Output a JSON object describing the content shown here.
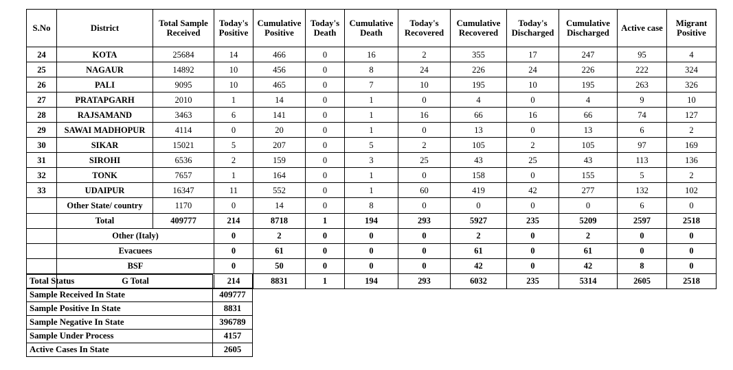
{
  "main_table": {
    "headers": [
      "S.No",
      "District",
      "Total Sample Received",
      "Today's Positive",
      "Cumulative Positive",
      "Today's Death",
      "Cumulative Death",
      "Today's Recovered",
      "Cumulative Recovered",
      "Today's Discharged",
      "Cumulative Discharged",
      "Active  case",
      "Migrant Positive"
    ],
    "rows": [
      {
        "sno": "24",
        "district": "KOTA",
        "total_sample_received": "25684",
        "todays_positive": "14",
        "cumulative_positive": "466",
        "todays_death": "0",
        "cumulative_death": "16",
        "todays_recovered": "2",
        "cumulative_recovered": "355",
        "todays_discharged": "17",
        "cumulative_discharged": "247",
        "active_case": "95",
        "migrant_positive": "4"
      },
      {
        "sno": "25",
        "district": "NAGAUR",
        "total_sample_received": "14892",
        "todays_positive": "10",
        "cumulative_positive": "456",
        "todays_death": "0",
        "cumulative_death": "8",
        "todays_recovered": "24",
        "cumulative_recovered": "226",
        "todays_discharged": "24",
        "cumulative_discharged": "226",
        "active_case": "222",
        "migrant_positive": "324"
      },
      {
        "sno": "26",
        "district": "PALI",
        "total_sample_received": "9095",
        "todays_positive": "10",
        "cumulative_positive": "465",
        "todays_death": "0",
        "cumulative_death": "7",
        "todays_recovered": "10",
        "cumulative_recovered": "195",
        "todays_discharged": "10",
        "cumulative_discharged": "195",
        "active_case": "263",
        "migrant_positive": "326"
      },
      {
        "sno": "27",
        "district": "PRATAPGARH",
        "total_sample_received": "2010",
        "todays_positive": "1",
        "cumulative_positive": "14",
        "todays_death": "0",
        "cumulative_death": "1",
        "todays_recovered": "0",
        "cumulative_recovered": "4",
        "todays_discharged": "0",
        "cumulative_discharged": "4",
        "active_case": "9",
        "migrant_positive": "10"
      },
      {
        "sno": "28",
        "district": "RAJSAMAND",
        "total_sample_received": "3463",
        "todays_positive": "6",
        "cumulative_positive": "141",
        "todays_death": "0",
        "cumulative_death": "1",
        "todays_recovered": "16",
        "cumulative_recovered": "66",
        "todays_discharged": "16",
        "cumulative_discharged": "66",
        "active_case": "74",
        "migrant_positive": "127"
      },
      {
        "sno": "29",
        "district": "SAWAI MADHOPUR",
        "total_sample_received": "4114",
        "todays_positive": "0",
        "cumulative_positive": "20",
        "todays_death": "0",
        "cumulative_death": "1",
        "todays_recovered": "0",
        "cumulative_recovered": "13",
        "todays_discharged": "0",
        "cumulative_discharged": "13",
        "active_case": "6",
        "migrant_positive": "2"
      },
      {
        "sno": "30",
        "district": "SIKAR",
        "total_sample_received": "15021",
        "todays_positive": "5",
        "cumulative_positive": "207",
        "todays_death": "0",
        "cumulative_death": "5",
        "todays_recovered": "2",
        "cumulative_recovered": "105",
        "todays_discharged": "2",
        "cumulative_discharged": "105",
        "active_case": "97",
        "migrant_positive": "169"
      },
      {
        "sno": "31",
        "district": "SIROHI",
        "total_sample_received": "6536",
        "todays_positive": "2",
        "cumulative_positive": "159",
        "todays_death": "0",
        "cumulative_death": "3",
        "todays_recovered": "25",
        "cumulative_recovered": "43",
        "todays_discharged": "25",
        "cumulative_discharged": "43",
        "active_case": "113",
        "migrant_positive": "136"
      },
      {
        "sno": "32",
        "district": "TONK",
        "total_sample_received": "7657",
        "todays_positive": "1",
        "cumulative_positive": "164",
        "todays_death": "0",
        "cumulative_death": "1",
        "todays_recovered": "0",
        "cumulative_recovered": "158",
        "todays_discharged": "0",
        "cumulative_discharged": "155",
        "active_case": "5",
        "migrant_positive": "2"
      },
      {
        "sno": "33",
        "district": "UDAIPUR",
        "total_sample_received": "16347",
        "todays_positive": "11",
        "cumulative_positive": "552",
        "todays_death": "0",
        "cumulative_death": "1",
        "todays_recovered": "60",
        "cumulative_recovered": "419",
        "todays_discharged": "42",
        "cumulative_discharged": "277",
        "active_case": "132",
        "migrant_positive": "102"
      },
      {
        "sno": "",
        "district": "Other State/ country",
        "total_sample_received": "1170",
        "todays_positive": "0",
        "cumulative_positive": "14",
        "todays_death": "0",
        "cumulative_death": "8",
        "todays_recovered": "0",
        "cumulative_recovered": "0",
        "todays_discharged": "0",
        "cumulative_discharged": "0",
        "active_case": "6",
        "migrant_positive": "0"
      }
    ],
    "total_row": {
      "label": "Total",
      "total_sample_received": "409777",
      "todays_positive": "214",
      "cumulative_positive": "8718",
      "todays_death": "1",
      "cumulative_death": "194",
      "todays_recovered": "293",
      "cumulative_recovered": "5927",
      "todays_discharged": "235",
      "cumulative_discharged": "5209",
      "active_case": "2597",
      "migrant_positive": "2518"
    },
    "summary_rows": [
      {
        "label": "Other (Italy)",
        "todays_positive": "0",
        "cumulative_positive": "2",
        "todays_death": "0",
        "cumulative_death": "0",
        "todays_recovered": "0",
        "cumulative_recovered": "2",
        "todays_discharged": "0",
        "cumulative_discharged": "2",
        "active_case": "0",
        "migrant_positive": "0"
      },
      {
        "label": "Evacuees",
        "todays_positive": "0",
        "cumulative_positive": "61",
        "todays_death": "0",
        "cumulative_death": "0",
        "todays_recovered": "0",
        "cumulative_recovered": "61",
        "todays_discharged": "0",
        "cumulative_discharged": "61",
        "active_case": "0",
        "migrant_positive": "0"
      },
      {
        "label": "BSF",
        "todays_positive": "0",
        "cumulative_positive": "50",
        "todays_death": "0",
        "cumulative_death": "0",
        "todays_recovered": "0",
        "cumulative_recovered": "42",
        "todays_discharged": "0",
        "cumulative_discharged": "42",
        "active_case": "8",
        "migrant_positive": "0"
      }
    ],
    "grand_total_row": {
      "label": "G Total",
      "todays_positive": "214",
      "cumulative_positive": "8831",
      "todays_death": "1",
      "cumulative_death": "194",
      "todays_recovered": "293",
      "cumulative_recovered": "6032",
      "todays_discharged": "235",
      "cumulative_discharged": "5314",
      "active_case": "2605",
      "migrant_positive": "2518"
    }
  },
  "status_table": {
    "title": "Total Status",
    "rows": [
      {
        "label": "Sample Received In State",
        "value": "409777"
      },
      {
        "label": "Sample Positive In State",
        "value": "8831"
      },
      {
        "label": "Sample Negative In State",
        "value": "396789"
      },
      {
        "label": "Sample Under Process",
        "value": "4157"
      },
      {
        "label": "Active Cases In State",
        "value": "2605"
      }
    ]
  }
}
